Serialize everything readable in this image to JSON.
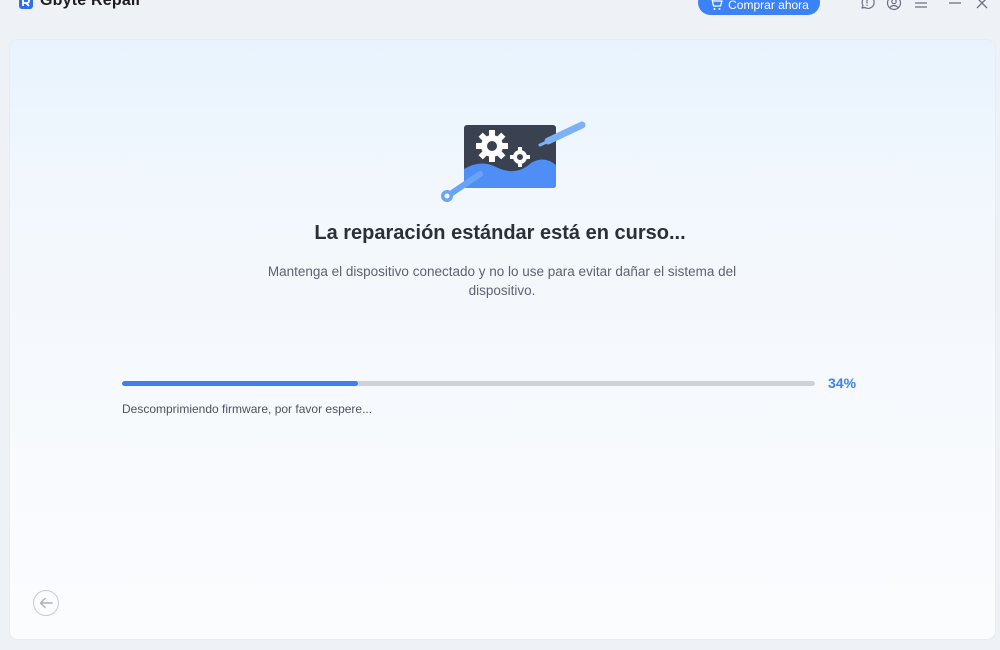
{
  "app": {
    "title": "Gbyte Repair",
    "buy_label": "Comprar ahora",
    "accent_color": "#3b82f6"
  },
  "titlebar_icons": [
    "feedback-icon",
    "account-icon",
    "menu-icon",
    "minimize-icon",
    "close-icon"
  ],
  "repair": {
    "title": "La reparación estándar está en curso...",
    "description": "Mantenga el dispositivo conectado y no lo use para evitar dañar el sistema del dispositivo.",
    "progress_percent": 34,
    "progress_label": "34%",
    "status_message": "Descomprimiendo firmware, por favor espere..."
  },
  "navigation": {
    "back_icon": "arrow-left-icon"
  }
}
